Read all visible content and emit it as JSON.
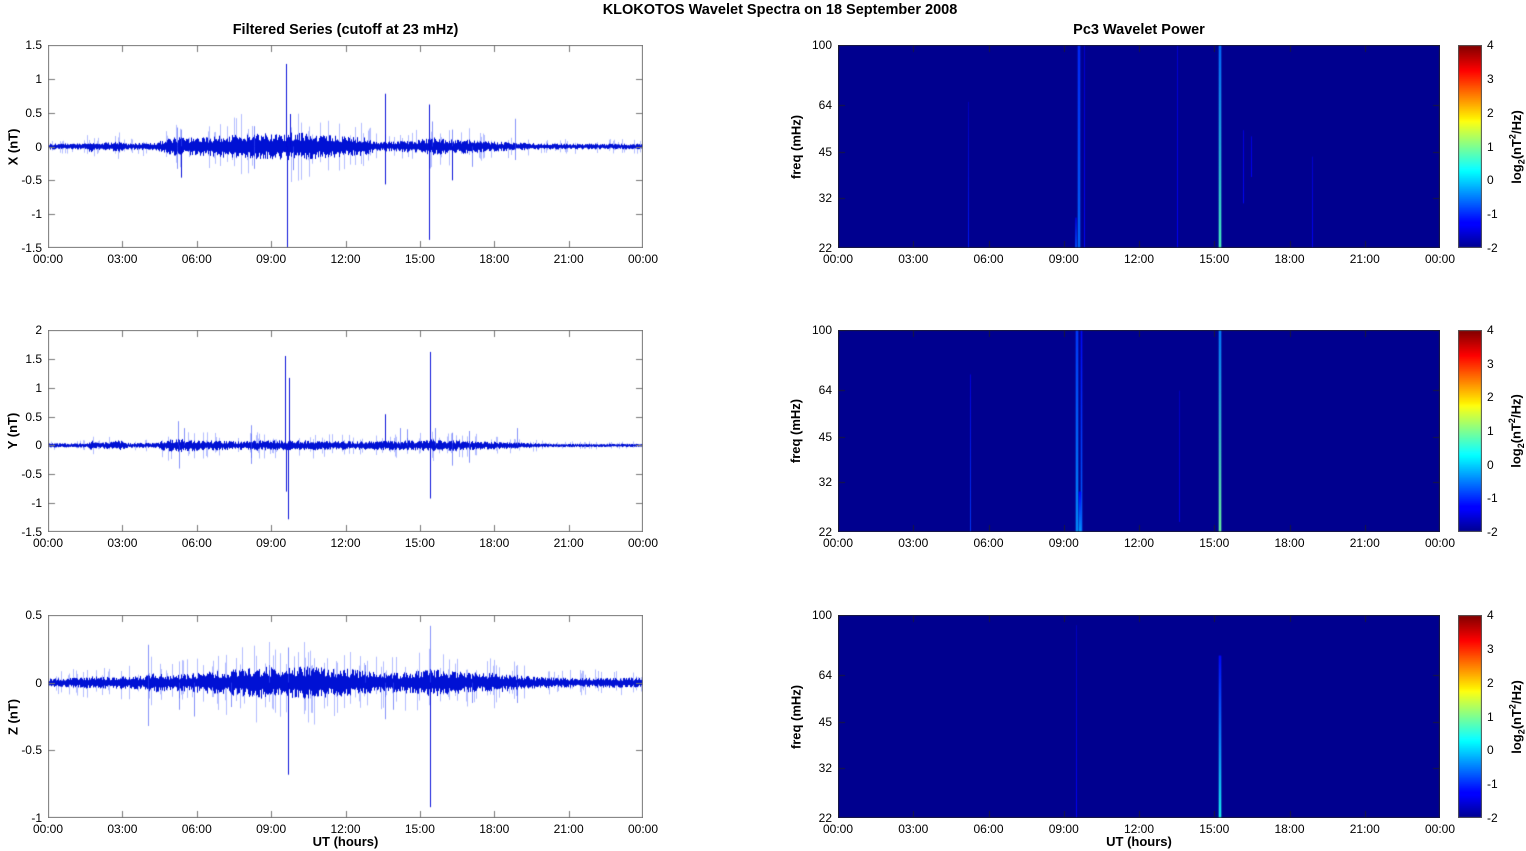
{
  "chart_data": {
    "figure_title": "KLOKOTOS Wavelet Spectra on 18 September 2008",
    "x_axis": {
      "label": "UT (hours)",
      "range_hours": [
        0,
        24
      ],
      "tick_hours": [
        0,
        3,
        6,
        9,
        12,
        15,
        18,
        21,
        24
      ],
      "tick_labels": [
        "00:00",
        "03:00",
        "06:00",
        "09:00",
        "12:00",
        "15:00",
        "18:00",
        "21:00",
        "00:00"
      ]
    },
    "timeseries": {
      "type": "line",
      "title": "Filtered Series (cutoff at 23 mHz)",
      "series_color": "#0011d4",
      "minor_color": "rgba(90,110,255,0.45)",
      "panels": [
        {
          "component": "X",
          "ylabel": "X (nT)",
          "ylim": [
            -1.5,
            1.5
          ],
          "yticks": [
            1.5,
            1,
            0.5,
            0,
            -0.5,
            -1,
            -1.5
          ],
          "ytick_labels": [
            "1.5",
            "1",
            "0.5",
            "0",
            "-0.5",
            "-1",
            "-1.5"
          ],
          "noise_envelope": [
            [
              0,
              0.03
            ],
            [
              1.5,
              0.03
            ],
            [
              1.7,
              0.07
            ],
            [
              1.9,
              0.03
            ],
            [
              2.9,
              0.055
            ],
            [
              3.1,
              0.03
            ],
            [
              4.3,
              0.04
            ],
            [
              5,
              0.09
            ],
            [
              6,
              0.09
            ],
            [
              7,
              0.11
            ],
            [
              8,
              0.13
            ],
            [
              9,
              0.13
            ],
            [
              10,
              0.14
            ],
            [
              11,
              0.12
            ],
            [
              12,
              0.1
            ],
            [
              12.8,
              0.09
            ],
            [
              13.2,
              0.05
            ],
            [
              14,
              0.05
            ],
            [
              15,
              0.07
            ],
            [
              15.6,
              0.09
            ],
            [
              16,
              0.08
            ],
            [
              17,
              0.07
            ],
            [
              18,
              0.05
            ],
            [
              19,
              0.04
            ],
            [
              20,
              0.03
            ],
            [
              24,
              0.028
            ]
          ],
          "spikes": [
            [
              5.2,
              0.28
            ],
            [
              5.35,
              0.25
            ],
            [
              8.3,
              0.3
            ],
            [
              9.6,
              1.22
            ],
            [
              9.75,
              0.48
            ],
            [
              13.6,
              0.78
            ],
            [
              15.35,
              0.62
            ],
            [
              15.5,
              0.37
            ],
            [
              16.3,
              0.25
            ],
            [
              18.85,
              0.41
            ],
            [
              5.2,
              -0.33
            ],
            [
              5.35,
              -0.46
            ],
            [
              8.3,
              -0.33
            ],
            [
              9.65,
              -1.5
            ],
            [
              9.9,
              -0.35
            ],
            [
              13.6,
              -0.56
            ],
            [
              15.38,
              -1.38
            ],
            [
              16.3,
              -0.5
            ],
            [
              17.1,
              -0.3
            ],
            [
              18.85,
              -0.2
            ]
          ]
        },
        {
          "component": "Y",
          "ylabel": "Y (nT)",
          "ylim": [
            -1.5,
            2
          ],
          "yticks": [
            2,
            1.5,
            1,
            0.5,
            0,
            -0.5,
            -1,
            -1.5
          ],
          "ytick_labels": [
            "2",
            "1.5",
            "1",
            "0.5",
            "0",
            "-0.5",
            "-1",
            "-1.5"
          ],
          "noise_envelope": [
            [
              0,
              0.025
            ],
            [
              1.6,
              0.025
            ],
            [
              1.75,
              0.08
            ],
            [
              1.95,
              0.03
            ],
            [
              2.9,
              0.06
            ],
            [
              3.15,
              0.03
            ],
            [
              4.4,
              0.03
            ],
            [
              4.6,
              0.06
            ],
            [
              5.2,
              0.08
            ],
            [
              5.6,
              0.07
            ],
            [
              6.5,
              0.06
            ],
            [
              7.5,
              0.05
            ],
            [
              8.5,
              0.06
            ],
            [
              9.5,
              0.06
            ],
            [
              10.5,
              0.06
            ],
            [
              11.5,
              0.05
            ],
            [
              12.5,
              0.05
            ],
            [
              13.5,
              0.06
            ],
            [
              14.5,
              0.06
            ],
            [
              15.5,
              0.07
            ],
            [
              16.5,
              0.06
            ],
            [
              17.5,
              0.05
            ],
            [
              18.5,
              0.04
            ],
            [
              19.5,
              0.03
            ],
            [
              20,
              0.02
            ],
            [
              24,
              0.02
            ]
          ],
          "spikes": [
            [
              5.25,
              0.42
            ],
            [
              5.5,
              0.3
            ],
            [
              8.2,
              0.35
            ],
            [
              9.55,
              1.55
            ],
            [
              9.72,
              1.17
            ],
            [
              13.6,
              0.54
            ],
            [
              14.2,
              0.3
            ],
            [
              14.5,
              0.28
            ],
            [
              15.4,
              1.62
            ],
            [
              15.6,
              0.3
            ],
            [
              16.3,
              0.22
            ],
            [
              17.0,
              0.25
            ],
            [
              18.9,
              0.3
            ],
            [
              5.3,
              -0.4
            ],
            [
              8.2,
              -0.32
            ],
            [
              9.6,
              -0.8
            ],
            [
              9.68,
              -1.28
            ],
            [
              15.42,
              -0.92
            ],
            [
              16.3,
              -0.35
            ],
            [
              17.0,
              -0.3
            ]
          ]
        },
        {
          "component": "Z",
          "ylabel": "Z (nT)",
          "ylim": [
            -1,
            0.5
          ],
          "yticks": [
            0.5,
            0,
            -0.5,
            -1
          ],
          "ytick_labels": [
            "0.5",
            "0",
            "-0.5",
            "-1"
          ],
          "noise_envelope": [
            [
              0,
              0.02
            ],
            [
              1.7,
              0.03
            ],
            [
              1.9,
              0.04
            ],
            [
              2.1,
              0.03
            ],
            [
              4,
              0.035
            ],
            [
              4.1,
              0.05
            ],
            [
              5,
              0.04
            ],
            [
              6,
              0.05
            ],
            [
              7,
              0.06
            ],
            [
              8,
              0.07
            ],
            [
              8.7,
              0.08
            ],
            [
              9.5,
              0.07
            ],
            [
              10,
              0.08
            ],
            [
              10.7,
              0.08
            ],
            [
              11.5,
              0.07
            ],
            [
              12,
              0.07
            ],
            [
              12.7,
              0.06
            ],
            [
              13.5,
              0.05
            ],
            [
              14,
              0.05
            ],
            [
              15,
              0.06
            ],
            [
              15.5,
              0.07
            ],
            [
              16,
              0.06
            ],
            [
              17,
              0.05
            ],
            [
              18,
              0.05
            ],
            [
              18.8,
              0.04
            ],
            [
              19.5,
              0.03
            ],
            [
              20.5,
              0.025
            ],
            [
              24,
              0.025
            ]
          ],
          "spikes": [
            [
              4.05,
              0.28
            ],
            [
              8.9,
              0.13
            ],
            [
              9.7,
              0.26
            ],
            [
              12.8,
              0.13
            ],
            [
              15.4,
              0.42
            ],
            [
              4.05,
              -0.32
            ],
            [
              5.3,
              -0.2
            ],
            [
              5.9,
              -0.25
            ],
            [
              7.4,
              -0.18
            ],
            [
              9.7,
              -0.68
            ],
            [
              13.6,
              -0.27
            ],
            [
              13.9,
              -0.2
            ],
            [
              15.42,
              -0.92
            ],
            [
              17.1,
              -0.15
            ],
            [
              18.9,
              -0.15
            ]
          ]
        }
      ]
    },
    "spectrograms": {
      "type": "heatmap",
      "title": "Pc3 Wavelet Power",
      "ylabel": "freq (mHz)",
      "freq_scale": "log",
      "freq_range": [
        22,
        100
      ],
      "freq_ticks": [
        100,
        64,
        45,
        32,
        22
      ],
      "freq_tick_labels": [
        "100",
        "64",
        "45",
        "32",
        "22"
      ],
      "background_value": -2,
      "panels": [
        {
          "component": "X",
          "events": [
            {
              "t": 5.2,
              "v_top": -1.7,
              "v_bottom": -1.1,
              "from": 0.28,
              "to": 1,
              "w": 1
            },
            {
              "t": 9.55,
              "v_top": -1.0,
              "v_bottom": -0.6,
              "from": 0,
              "to": 1,
              "w": 2
            },
            {
              "t": 9.45,
              "v_top": -1.6,
              "v_bottom": -0.8,
              "from": 0.85,
              "to": 1,
              "w": 2
            },
            {
              "t": 9.8,
              "v_top": -1.6,
              "v_bottom": -1.2,
              "from": 0,
              "to": 1,
              "w": 1
            },
            {
              "t": 13.5,
              "v_top": -1.6,
              "v_bottom": -1.3,
              "from": 0,
              "to": 1,
              "w": 1
            },
            {
              "t": 15.2,
              "v_top": -0.6,
              "v_bottom": 0.7,
              "from": 0,
              "to": 1,
              "w": 2
            },
            {
              "t": 16.15,
              "v_top": -1.5,
              "v_bottom": -1.2,
              "from": 0.42,
              "to": 0.78,
              "w": 1
            },
            {
              "t": 16.45,
              "v_top": -1.5,
              "v_bottom": -1.3,
              "from": 0.45,
              "to": 0.65,
              "w": 1
            },
            {
              "t": 18.9,
              "v_top": -1.6,
              "v_bottom": -1.3,
              "from": 0.55,
              "to": 1,
              "w": 1
            }
          ]
        },
        {
          "component": "Y",
          "events": [
            {
              "t": 5.25,
              "v_top": -1.5,
              "v_bottom": -0.9,
              "from": 0.22,
              "to": 1,
              "w": 1
            },
            {
              "t": 9.5,
              "v_top": -0.9,
              "v_bottom": -0.4,
              "from": 0,
              "to": 1,
              "w": 2
            },
            {
              "t": 9.7,
              "v_top": -1.2,
              "v_bottom": -0.6,
              "from": 0,
              "to": 1,
              "w": 1
            },
            {
              "t": 9.6,
              "v_top": -1.3,
              "v_bottom": -0.3,
              "from": 0.8,
              "to": 1,
              "w": 2
            },
            {
              "t": 13.6,
              "v_top": -1.7,
              "v_bottom": -1.4,
              "from": 0.3,
              "to": 0.95,
              "w": 1
            },
            {
              "t": 15.2,
              "v_top": -0.5,
              "v_bottom": 0.9,
              "from": 0,
              "to": 1,
              "w": 2
            }
          ]
        },
        {
          "component": "Z",
          "events": [
            {
              "t": 9.5,
              "v_top": -1.7,
              "v_bottom": -1.3,
              "from": 0.05,
              "to": 1,
              "w": 1
            },
            {
              "t": 15.2,
              "v_top": -1.2,
              "v_bottom": 0.4,
              "from": 0.2,
              "to": 1,
              "w": 2
            }
          ]
        }
      ],
      "colorbar": {
        "range": [
          -2,
          4
        ],
        "ticks": [
          4,
          3,
          2,
          1,
          0,
          -1,
          -2
        ],
        "tick_labels": [
          "4",
          "3",
          "2",
          "1",
          "0",
          "-1",
          "-2"
        ],
        "label_parts": {
          "p1": "log",
          "sub": "2",
          "p2": "(nT",
          "sup": "2",
          "p3": "/Hz)"
        }
      }
    },
    "colors": {
      "axis": "#777777",
      "spectrogram_background": "#00008f",
      "series": "#0011d4"
    }
  }
}
